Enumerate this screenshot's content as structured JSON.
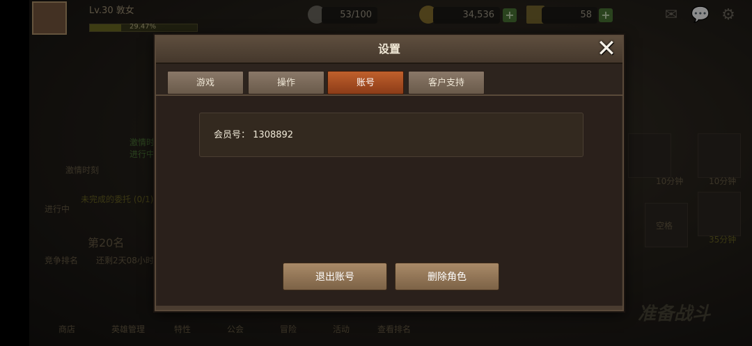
{
  "background": {
    "player_level": "Lv.30",
    "player_name": "敦女",
    "exp_text": "29.47%",
    "exp_progress": 0.2947,
    "stamina": "53/100",
    "gold": "34,536",
    "gems": "58",
    "left_panel": {
      "timer_label": "激情时刻",
      "timer_status": "激情时\n进行中",
      "quest_text": "未完成的委托 (0/1)",
      "quest_status": "进行中",
      "rank": "第20名",
      "rank_label": "竞争排名",
      "rank_sub": "还剩2天08小时"
    },
    "bottom_nav": [
      "商店",
      "英雄管理",
      "特性",
      "公会",
      "冒险",
      "活动",
      "查看排名"
    ],
    "right_panel": {
      "chest_labels": [
        "10分钟",
        "10分钟"
      ],
      "empty_slot": "空格",
      "small_timer": "35分钟",
      "battle": "准备战斗"
    }
  },
  "dialog": {
    "title": "设置",
    "close_icon": "close-x-icon",
    "tabs": [
      {
        "label": "游戏",
        "active": false
      },
      {
        "label": "操作",
        "active": false
      },
      {
        "label": "账号",
        "active": true
      },
      {
        "label": "客户支持",
        "active": false
      }
    ],
    "member_label": "会员号：",
    "member_id": "1308892",
    "logout_label": "退出账号",
    "delete_label": "删除角色"
  },
  "colors": {
    "active_tab": "#c0602c",
    "button": "#a98a68",
    "dialog_bg": "#2d241e"
  }
}
